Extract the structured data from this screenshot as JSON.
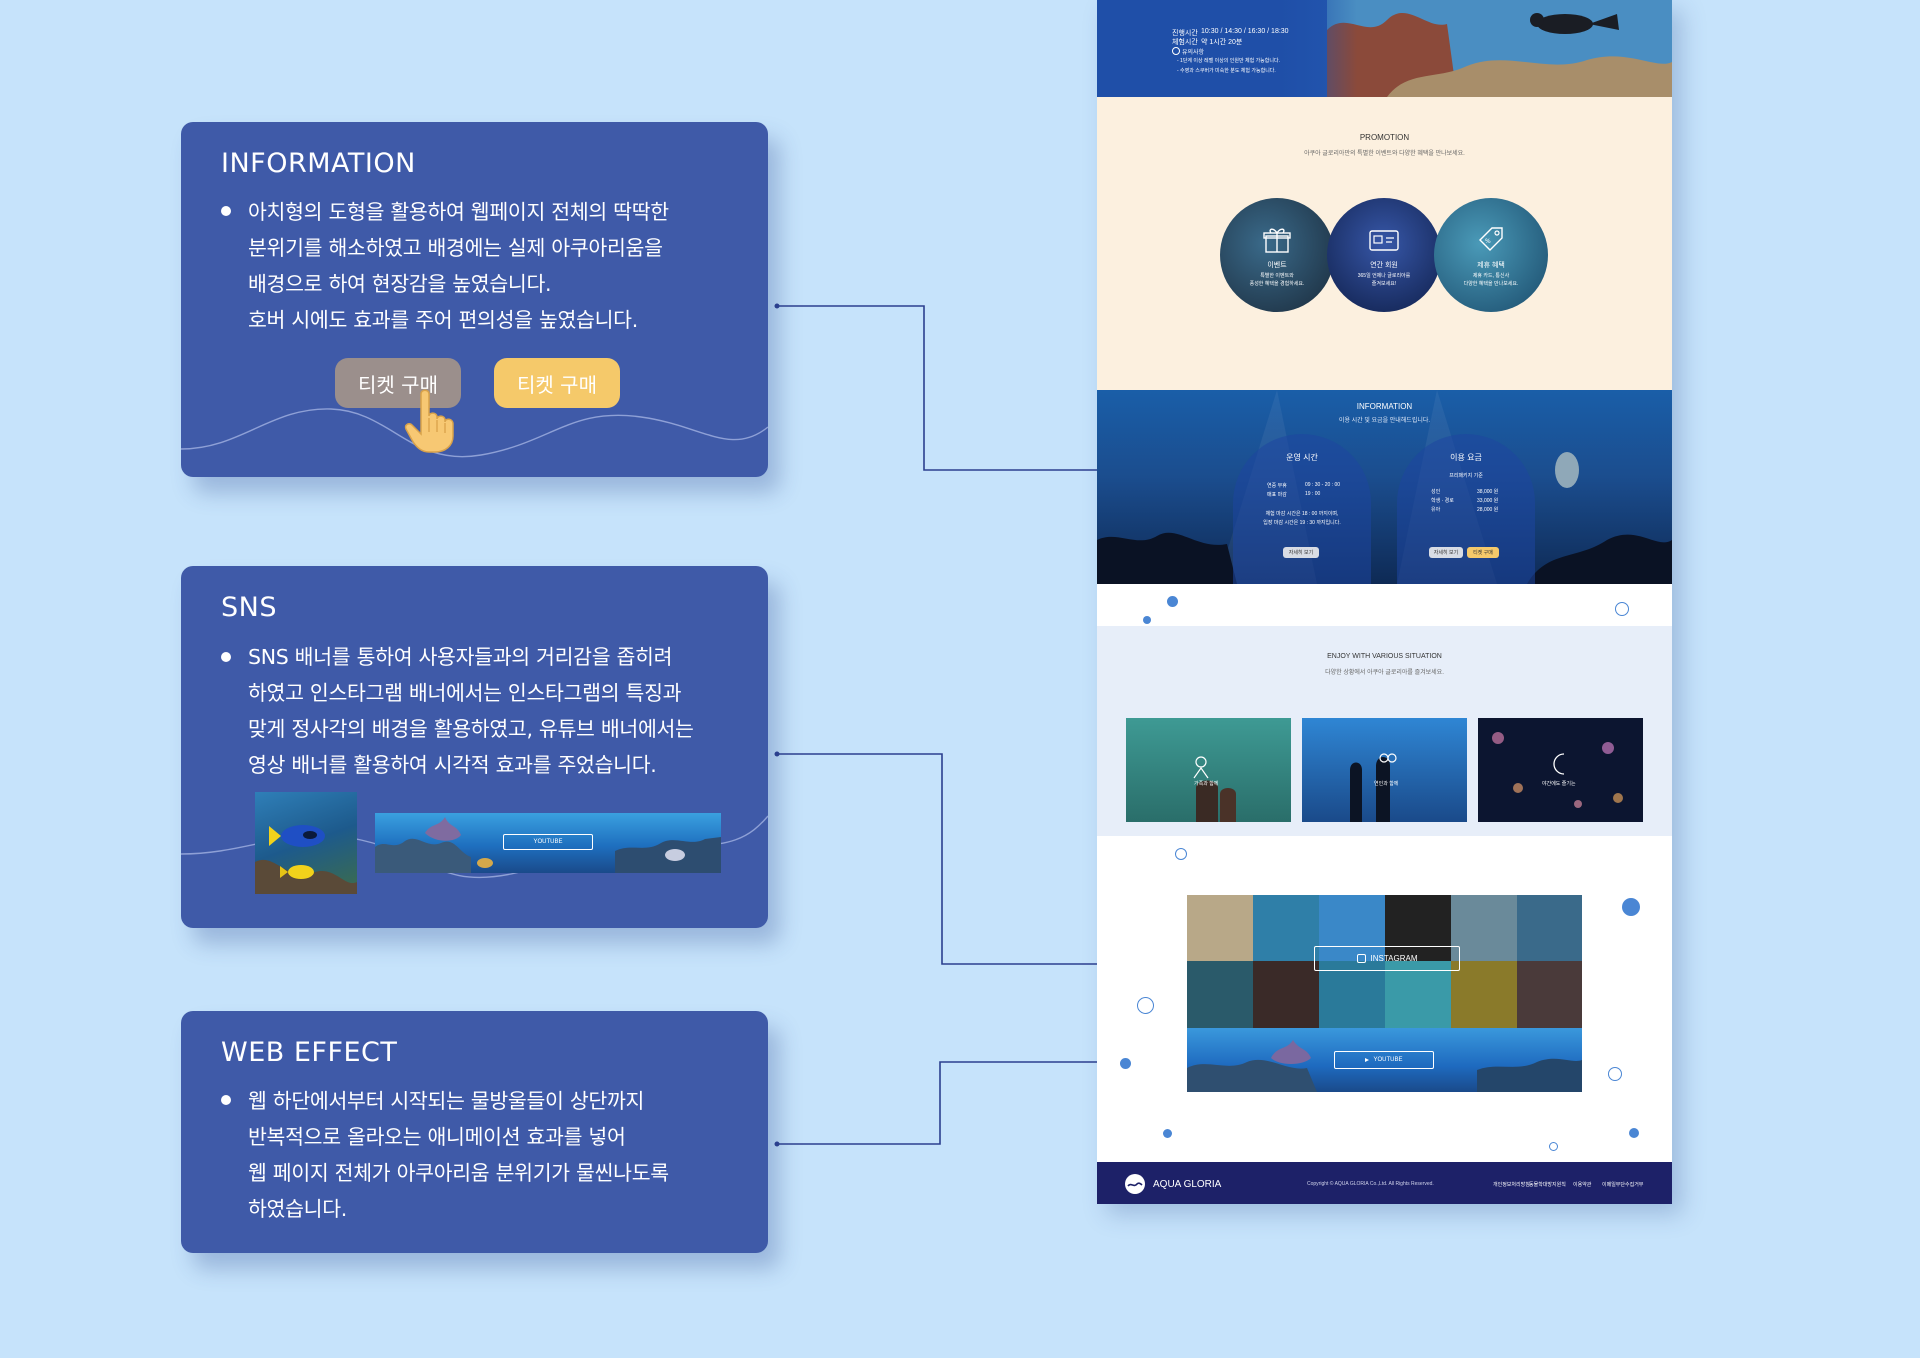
{
  "cards": {
    "information": {
      "title": "INFORMATION",
      "lines": [
        "아치형의 도형을 활용하여 웹페이지 전체의 딱딱한",
        "분위기를 해소하였고 배경에는 실제 아쿠아리움을",
        "배경으로 하여 현장감을 높였습니다.",
        "호버 시에도 효과를 주어 편의성을 높였습니다."
      ],
      "button_default": "티켓 구매",
      "button_hover": "티켓 구매"
    },
    "sns": {
      "title": "SNS",
      "lines": [
        "SNS 배너를 통하여 사용자들과의 거리감을 좁히려",
        "하였고 인스타그램 배너에서는 인스타그램의 특징과",
        "맞게 정사각의 배경을 활용하였고, 유튜브 배너에서는",
        "영상 배너를 활용하여 시각적 효과를 주었습니다."
      ],
      "youtube_label": "YOUTUBE"
    },
    "web_effect": {
      "title": "WEB EFFECT",
      "lines": [
        "웹 하단에서부터 시작되는 물방울들이 상단까지",
        "반복적으로 올라오는 애니메이션 효과를 넣어",
        "웹 페이지 전체가 아쿠아리움 분위기가 물씬나도록",
        "하였습니다."
      ]
    }
  },
  "site": {
    "hero": {
      "rows": [
        {
          "label": "진행시간",
          "value": "10:30 / 14:30 / 16:30 / 18:30"
        },
        {
          "label": "체험시간",
          "value": "약 1시간 20분"
        }
      ],
      "notice_title": "유의사항",
      "notices": [
        "- 1단계 이상 레벨 이상의 인원만 체험 가능합니다.",
        "- 수영과 스쿠버가 미숙한 분도 체험 가능합니다."
      ]
    },
    "promotion": {
      "title": "PROMOTION",
      "subtitle": "아쿠아 글로리아만의 특별한 이벤트와 다양한 혜택을 만나보세요.",
      "items": [
        {
          "label": "이벤트",
          "desc1": "특별한 이벤트와",
          "desc2": "풍성한 혜택을 경험하세요.",
          "icon": "gift-icon"
        },
        {
          "label": "연간 회원",
          "desc1": "365일 언제나 글로리아를",
          "desc2": "즐겨보세요!",
          "icon": "card-icon"
        },
        {
          "label": "제휴 혜택",
          "desc1": "제휴 카드, 통신사",
          "desc2": "다양한 혜택을 만나보세요.",
          "icon": "sale-tag-icon"
        }
      ]
    },
    "information": {
      "title": "INFORMATION",
      "subtitle": "이용 시간 및 요금을 안내해드립니다.",
      "hours": {
        "title": "운영 시간",
        "rows": [
          {
            "label": "연중 무휴",
            "value": "09 : 30 - 20 : 00"
          },
          {
            "label": "매표 마감",
            "value": "19 : 00"
          }
        ],
        "note1": "체험 마감 시간은 18 : 00 까지이며,",
        "note2": "입장 마감 시간은 19 : 30 까지입니다.",
        "button": "자세히 보기"
      },
      "fees": {
        "title": "이용 요금",
        "caption": "프리패키지 기준",
        "rows": [
          {
            "label": "성인",
            "value": "38,000 원"
          },
          {
            "label": "학생 · 경로",
            "value": "33,000 원"
          },
          {
            "label": "유아",
            "value": "28,000 원"
          }
        ],
        "button_more": "자세히 보기",
        "button_buy": "티켓 구매"
      }
    },
    "situation": {
      "title": "ENJOY WITH VARIOUS SITUATION",
      "subtitle": "다양한 상황에서 아쿠아 글로리아를 즐겨보세요.",
      "items": [
        {
          "label": "가족과 함께",
          "icon": "family-icon"
        },
        {
          "label": "연인과 함께",
          "icon": "couple-icon"
        },
        {
          "label": "야간에도 즐기는",
          "icon": "moon-icon"
        }
      ]
    },
    "sns": {
      "instagram": "INSTAGRAM",
      "youtube": "YOUTUBE"
    },
    "footer": {
      "brand": "AQUA GLORIA",
      "copyright": "Copyright © AQUA GLORIA Co.,Ltd. All Rights Reserved.",
      "links": [
        "개인정보처리방침",
        "동물학대방지원칙",
        "이용약관",
        "이메일무단수집거부"
      ]
    }
  },
  "colors": {
    "page_bg": "#c6e3fb",
    "card_bg": "#3f5aa8",
    "accent_yellow": "#f5c96a",
    "hover_gray": "#9b8f8c",
    "footer_navy": "#1d2168"
  }
}
